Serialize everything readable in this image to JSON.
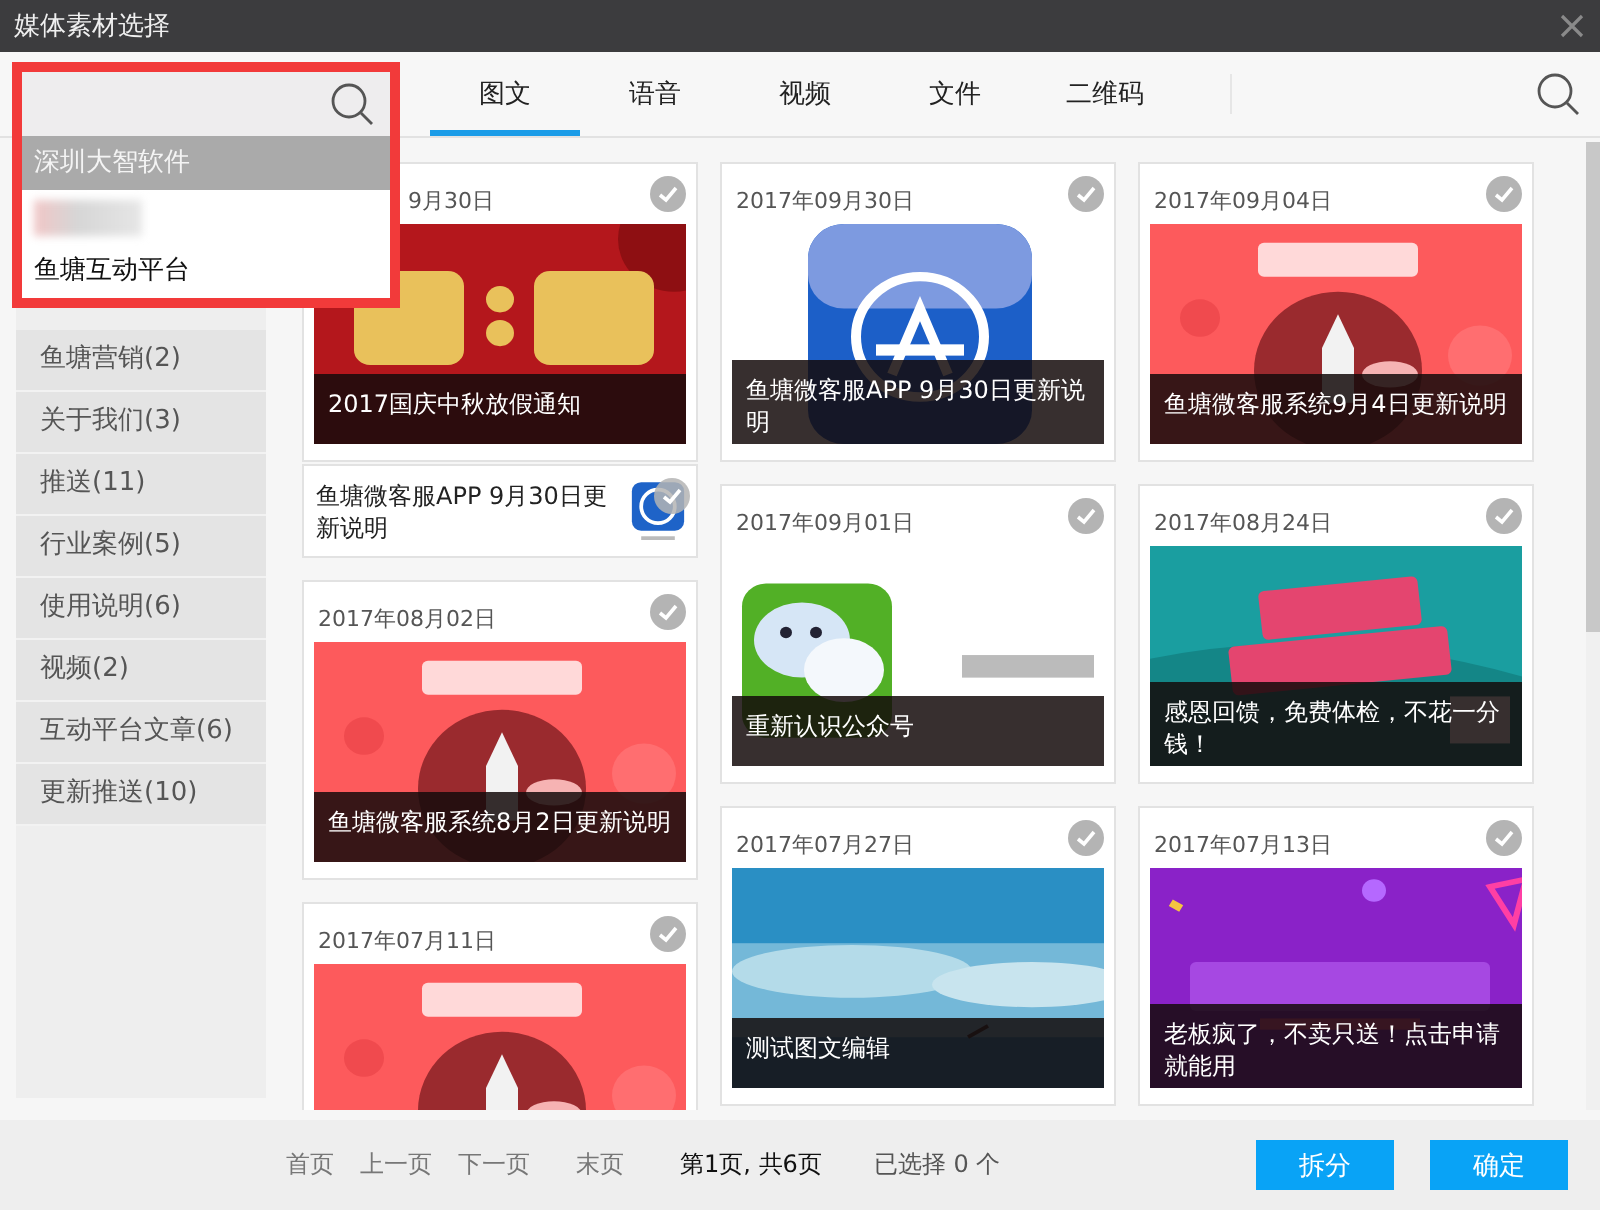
{
  "window": {
    "title": "媒体素材选择"
  },
  "account_dropdown": {
    "items": [
      {
        "kind": "text",
        "label": "深圳大智软件",
        "selected": true
      },
      {
        "kind": "blurred",
        "selected": false
      },
      {
        "kind": "text",
        "label": "鱼塘互动平台",
        "selected": false
      }
    ]
  },
  "sidebar": {
    "items": [
      {
        "label": "鱼塘营销(2)",
        "selected": false
      },
      {
        "label": "关于我们(3)",
        "selected": false
      },
      {
        "label": "推送(11)",
        "selected": false
      },
      {
        "label": "行业案例(5)",
        "selected": false
      },
      {
        "label": "使用说明(6)",
        "selected": false
      },
      {
        "label": "视频(2)",
        "selected": false
      },
      {
        "label": "互动平台文章(6)",
        "selected": false
      },
      {
        "label": "更新推送(10)",
        "selected": false
      }
    ]
  },
  "tabs": [
    {
      "label": "图文",
      "selected": true
    },
    {
      "label": "语音",
      "selected": false
    },
    {
      "label": "视频",
      "selected": false
    },
    {
      "label": "文件",
      "selected": false
    },
    {
      "label": "二维码",
      "selected": false
    }
  ],
  "columns": [
    [
      {
        "date": "9月30日",
        "covered": true,
        "caption": "2017国庆中秋放假通知",
        "selected": false,
        "more": [
          {
            "title": "鱼塘微客服APP  9月30日更新说明",
            "selected": false
          }
        ]
      },
      {
        "date": "2017年08月02日",
        "covered": false,
        "caption": "鱼塘微客服系统8月2日更新说明",
        "selected": false
      },
      {
        "date": "2017年07月11日",
        "covered": false,
        "selected": false
      }
    ],
    [
      {
        "date": "2017年09月30日",
        "covered": false,
        "caption": "鱼塘微客服APP  9月30日更新说明",
        "selected": false
      },
      {
        "date": "2017年09月01日",
        "covered": false,
        "caption": "重新认识公众号",
        "selected": false
      },
      {
        "date": "2017年07月27日",
        "covered": false,
        "caption": "测试图文编辑",
        "selected": false
      }
    ],
    [
      {
        "date": "2017年09月04日",
        "covered": false,
        "caption": "鱼塘微客服系统9月4日更新说明",
        "selected": false
      },
      {
        "date": "2017年08月24日",
        "covered": false,
        "caption": "感恩回馈，免费体检，不花一分钱！",
        "selected": false
      },
      {
        "date": "2017年07月13日",
        "covered": false,
        "caption": "老板疯了，不卖只送！点击申请就能用",
        "selected": false
      }
    ]
  ],
  "pagination": {
    "links": [
      "首页",
      "上一页",
      "下一页",
      "末页"
    ],
    "page_info": "第1页, 共6页",
    "selection": "已选择 0 个"
  },
  "buttons": [
    "拆分",
    "确定"
  ]
}
